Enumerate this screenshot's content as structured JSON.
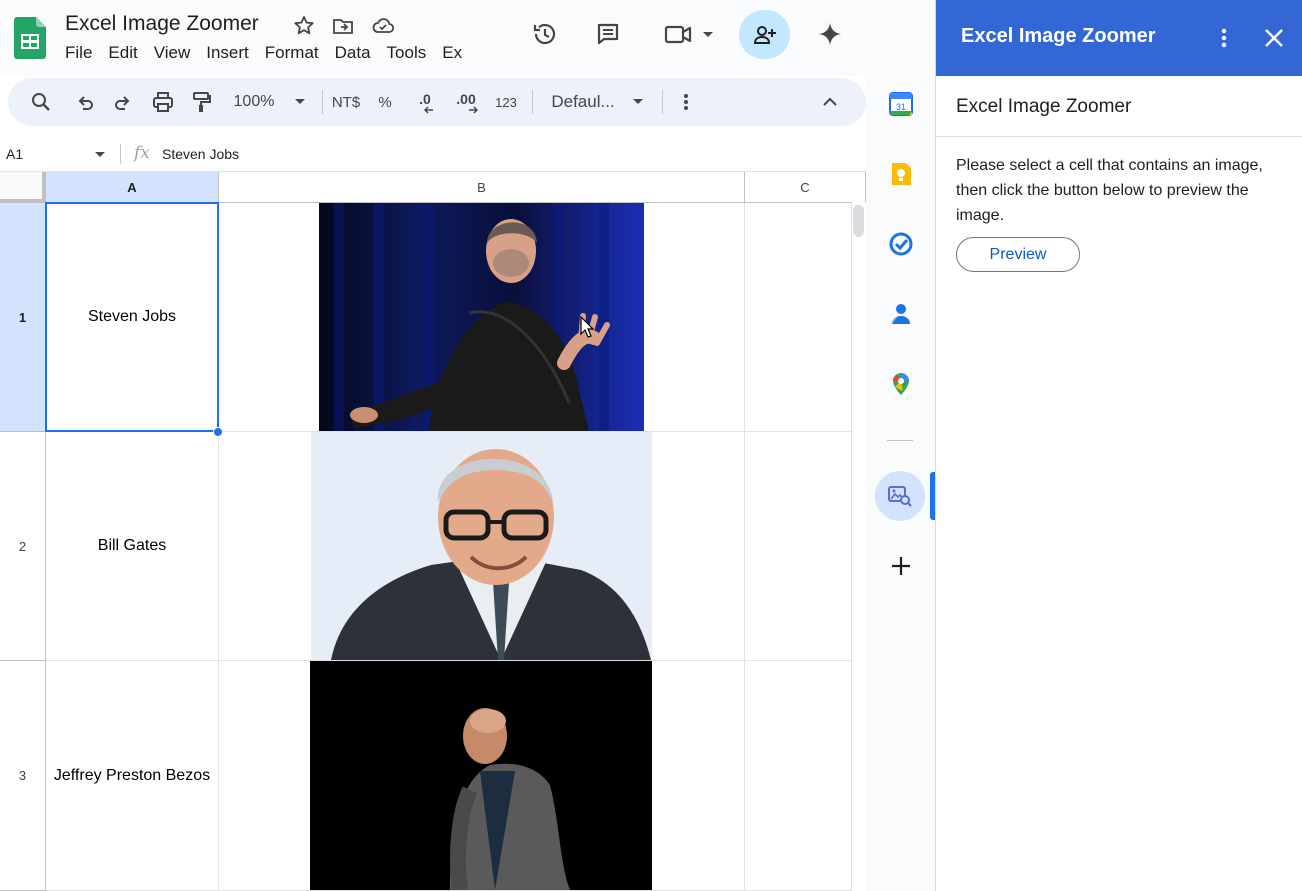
{
  "doc": {
    "title": "Excel Image Zoomer"
  },
  "menu": [
    "File",
    "Edit",
    "View",
    "Insert",
    "Format",
    "Data",
    "Tools",
    "Ex"
  ],
  "toolbar": {
    "zoom": "100%",
    "currency": "NT$",
    "percent": "%",
    "dec_decrease": ".0",
    "dec_increase": ".00",
    "number_format": "123",
    "font": "Defaul..."
  },
  "formula_bar": {
    "name_box": "A1",
    "fx": "fx",
    "value": "Steven Jobs"
  },
  "columns": [
    "A",
    "B",
    "C"
  ],
  "rows": [
    {
      "num": "1",
      "name": "Steven Jobs"
    },
    {
      "num": "2",
      "name": "Bill Gates"
    },
    {
      "num": "3",
      "name": "Jeffrey Preston Bezos"
    }
  ],
  "panel": {
    "header": "Excel Image Zoomer",
    "subtitle": "Excel Image Zoomer",
    "instructions": "Please select a cell that contains an image, then click the button below to preview the image.",
    "preview_button": "Preview"
  },
  "rail": {
    "calendar_day": "31"
  },
  "colors": {
    "panel_header": "#3367d6",
    "selection": "#1a73e8",
    "share_bg": "#c2e7ff"
  }
}
